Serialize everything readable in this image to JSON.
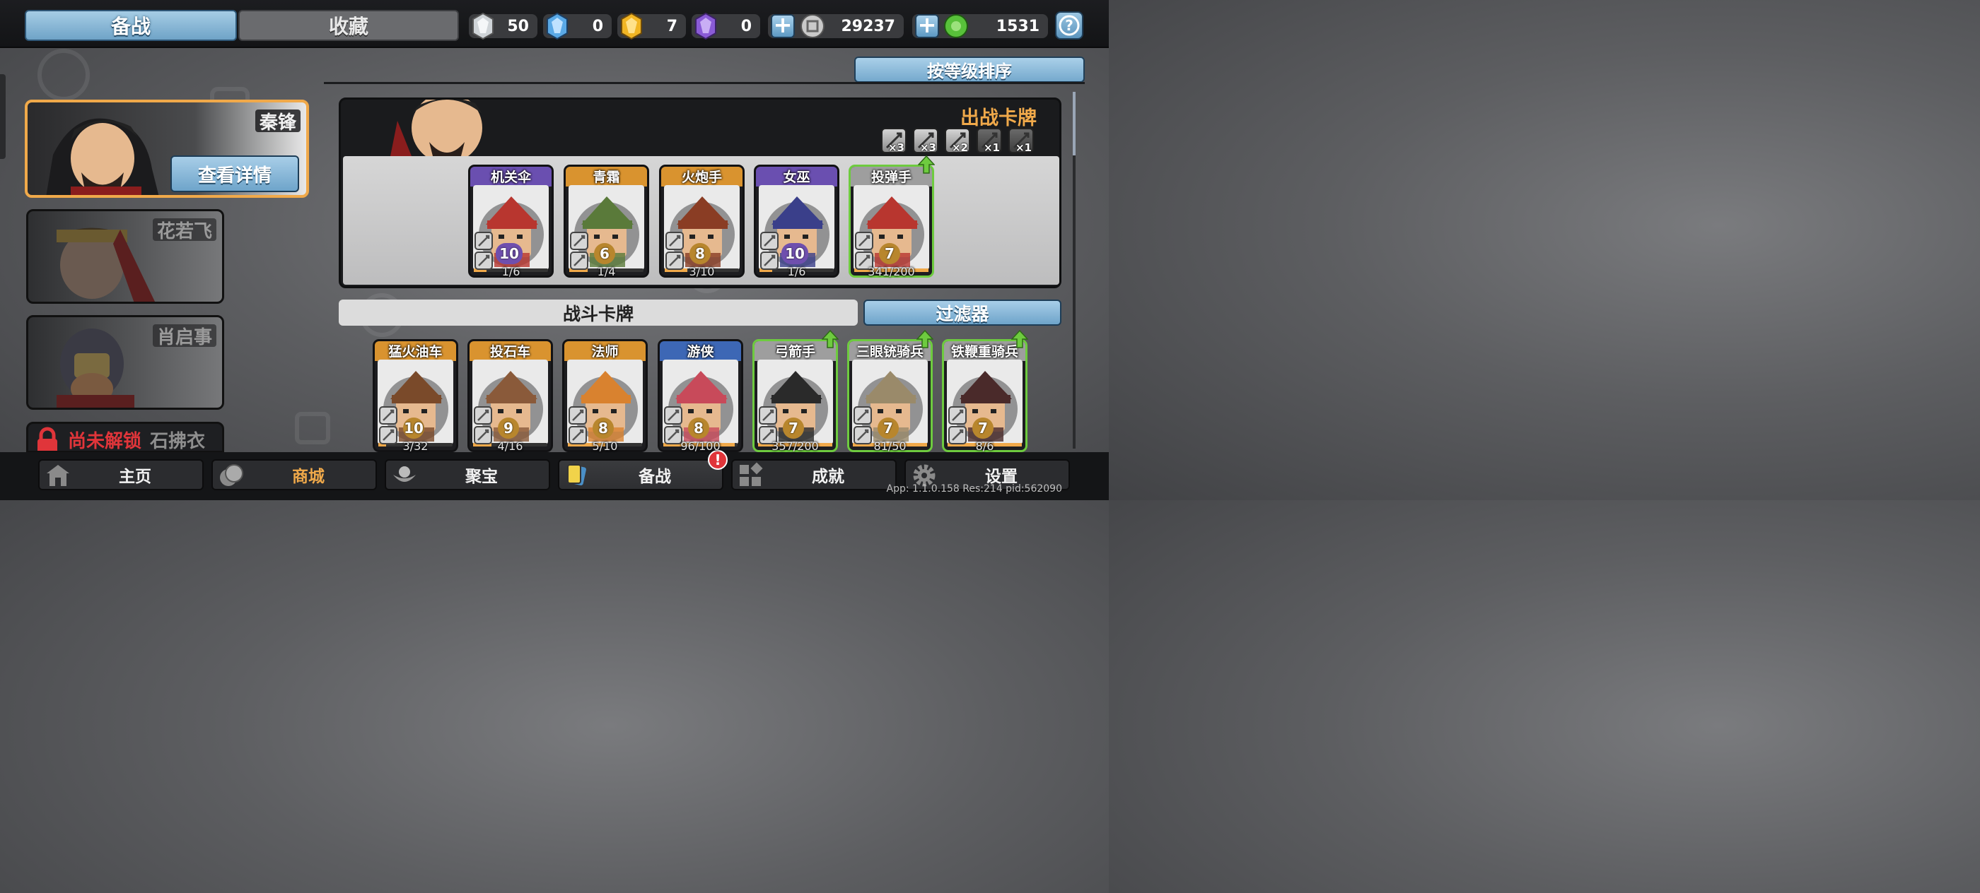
{
  "tabs": {
    "active": "备战",
    "other": "收藏"
  },
  "resources": [
    {
      "icon": "silver-crystal-icon",
      "value": "50",
      "color": "#cfd4d8"
    },
    {
      "icon": "blue-crystal-icon",
      "value": "0",
      "color": "#5aa9e6"
    },
    {
      "icon": "gold-crystal-icon",
      "value": "7",
      "color": "#f1b524"
    },
    {
      "icon": "purple-crystal-icon",
      "value": "0",
      "color": "#8a5bd6"
    },
    {
      "icon": "silver-coin-icon",
      "value": "29237",
      "color": "#c9c9c9"
    },
    {
      "icon": "jade-coin-icon",
      "value": "1531",
      "color": "#58c13a"
    }
  ],
  "sort_button": "按等级排序",
  "heroes": [
    {
      "name": "秦锋",
      "detail": "查看详情",
      "selected": true
    },
    {
      "name": "花若飞"
    },
    {
      "name": "肖启事"
    }
  ],
  "locked_hero": {
    "lock_text": "尚未解锁",
    "name": "石拂衣"
  },
  "deck": {
    "title": "出战卡牌",
    "caps": [
      {
        "icon": "sword-icon",
        "count": "×3",
        "active": true
      },
      {
        "icon": "helmet-icon",
        "count": "×3",
        "active": true
      },
      {
        "icon": "armor-icon",
        "count": "×2",
        "active": true
      },
      {
        "icon": "sword-icon",
        "count": "×1",
        "active": false
      },
      {
        "icon": "skull-icon",
        "count": "×1",
        "active": false
      }
    ],
    "cards": [
      {
        "name": "机关伞",
        "level": "10",
        "count": "1/6",
        "rarity": "#6a4fb0",
        "progress": 0.17,
        "upgrade": false,
        "lvstyle": "purple"
      },
      {
        "name": "青霜",
        "level": "6",
        "count": "1/4",
        "rarity": "#d9932f",
        "progress": 0.25,
        "upgrade": false
      },
      {
        "name": "火炮手",
        "level": "8",
        "count": "3/10",
        "rarity": "#d9932f",
        "progress": 0.3,
        "upgrade": false
      },
      {
        "name": "女巫",
        "level": "10",
        "count": "1/6",
        "rarity": "#6a4fb0",
        "progress": 0.17,
        "upgrade": false,
        "lvstyle": "purple"
      },
      {
        "name": "投弹手",
        "level": "7",
        "count": "341/200",
        "rarity": "#9e9e9e",
        "progress": 1,
        "upgrade": true
      }
    ]
  },
  "battle": {
    "title": "战斗卡牌",
    "filter": "过滤器",
    "cards": [
      {
        "name": "猛火油车",
        "level": "10",
        "count": "3/32",
        "rarity": "#d9932f",
        "progress": 0.1,
        "upgrade": false
      },
      {
        "name": "投石车",
        "level": "9",
        "count": "4/16",
        "rarity": "#d9932f",
        "progress": 0.25,
        "upgrade": false
      },
      {
        "name": "法师",
        "level": "8",
        "count": "5/10",
        "rarity": "#d9932f",
        "progress": 0.5,
        "upgrade": false
      },
      {
        "name": "游侠",
        "level": "8",
        "count": "96/100",
        "rarity": "#3d67b5",
        "progress": 0.96,
        "upgrade": false
      },
      {
        "name": "弓箭手",
        "level": "7",
        "count": "357/200",
        "rarity": "#9e9e9e",
        "progress": 1,
        "upgrade": true
      },
      {
        "name": "三眼铳骑兵",
        "level": "7",
        "count": "81/50",
        "rarity": "#9e9e9e",
        "progress": 1,
        "upgrade": true
      },
      {
        "name": "铁鞭重骑兵",
        "level": "7",
        "count": "8/6",
        "rarity": "#9e9e9e",
        "progress": 1,
        "upgrade": true
      }
    ]
  },
  "nav": [
    {
      "label": "主页",
      "icon": "home-icon"
    },
    {
      "label": "商城",
      "icon": "coins-icon"
    },
    {
      "label": "聚宝",
      "icon": "treasure-icon"
    },
    {
      "label": "备战",
      "icon": "cards-icon",
      "active": true,
      "badge": "!"
    },
    {
      "label": "成就",
      "icon": "achievement-icon"
    },
    {
      "label": "设置",
      "icon": "gear-icon"
    }
  ],
  "version": "App: 1.1.0.158 Res:214 pid:562090"
}
